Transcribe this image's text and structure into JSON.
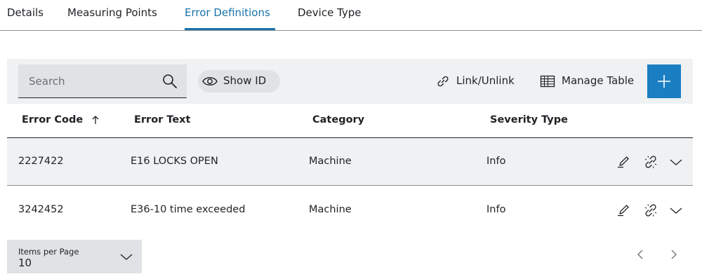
{
  "tabs": [
    {
      "label": "Details",
      "active": false
    },
    {
      "label": "Measuring Points",
      "active": false
    },
    {
      "label": "Error Definitions",
      "active": true
    },
    {
      "label": "Device Type",
      "active": false
    }
  ],
  "toolbar": {
    "search_placeholder": "Search",
    "show_id_label": "Show ID",
    "link_unlink_label": "Link/Unlink",
    "manage_table_label": "Manage Table",
    "add_icon": "plus-icon"
  },
  "table": {
    "columns": [
      "Error Code",
      "Error Text",
      "Category",
      "Severity Type"
    ],
    "sorted_column": "Error Code",
    "sort_direction": "ascending",
    "rows": [
      {
        "code": "2227422",
        "text": "E16 LOCKS OPEN",
        "category": "Machine",
        "severity": "Info"
      },
      {
        "code": "3242452",
        "text": "E36-10 time exceeded",
        "category": "Machine",
        "severity": "Info"
      }
    ],
    "row_actions": [
      "edit-icon",
      "unlink-icon",
      "chevron-down-icon"
    ]
  },
  "pagination": {
    "items_per_page_label": "Items per Page",
    "items_per_page_value": "10"
  },
  "colors": {
    "accent": "#1a7ec3",
    "active_tab": "#1a73a8",
    "toolbar_bg": "#eff1f2",
    "input_bg": "#e0e2e5"
  }
}
